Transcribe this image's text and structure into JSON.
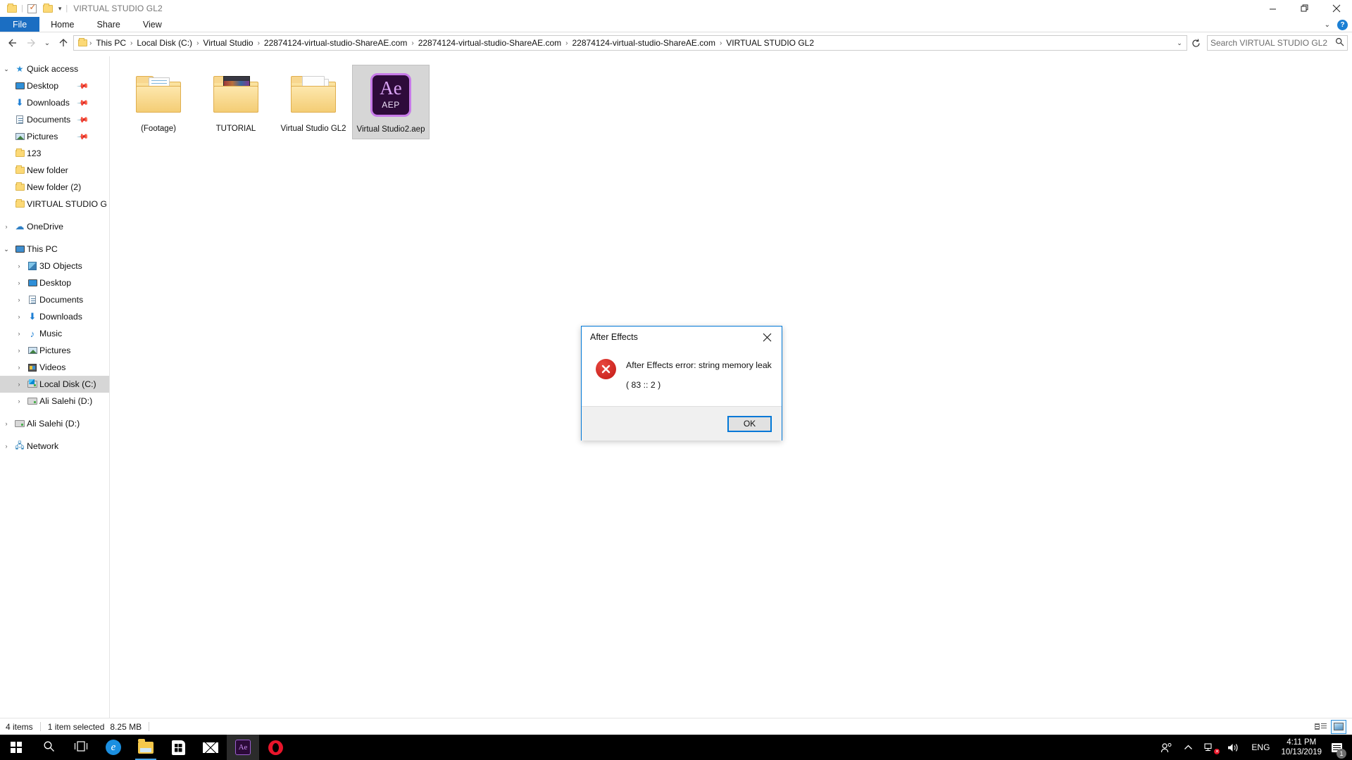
{
  "window": {
    "title": "VIRTUAL STUDIO GL2",
    "quick_access_toolbar": [
      {
        "name": "folder-properties-icon",
        "glyph": "folder"
      },
      {
        "name": "checkbox-icon",
        "glyph": "checkbox"
      },
      {
        "name": "new-folder-icon",
        "glyph": "folder"
      },
      {
        "name": "customize-qat-caret",
        "glyph": "▾"
      }
    ],
    "controls": {
      "minimize": "—",
      "restore": "❐",
      "close": "✕",
      "ribbon_collapse": "⌄",
      "help": "?"
    }
  },
  "ribbon": {
    "tabs": [
      {
        "label": "File",
        "active": true
      },
      {
        "label": "Home",
        "active": false
      },
      {
        "label": "Share",
        "active": false
      },
      {
        "label": "View",
        "active": false
      }
    ]
  },
  "nav": {
    "back_icon": "←",
    "forward_icon": "→",
    "recent_icon": "⌄",
    "up_icon": "↑",
    "refresh_icon": "⟳",
    "breadcrumbs": [
      "This PC",
      "Local Disk (C:)",
      "Virtual Studio",
      "22874124-virtual-studio-ShareAE.com",
      "22874124-virtual-studio-ShareAE.com",
      "22874124-virtual-studio-ShareAE.com",
      "VIRTUAL STUDIO GL2"
    ],
    "separator": "›",
    "dropdown_caret": "⌄"
  },
  "search": {
    "placeholder": "Search VIRTUAL STUDIO GL2",
    "icon": "⚲"
  },
  "sidebar": {
    "groups": [
      {
        "name": "quick-access",
        "label": "Quick access",
        "chevron": "⌄",
        "icon": "star-icon",
        "items": [
          {
            "label": "Desktop",
            "icon": "desktop-icon",
            "pinned": true
          },
          {
            "label": "Downloads",
            "icon": "downloads-icon",
            "pinned": true
          },
          {
            "label": "Documents",
            "icon": "documents-icon",
            "pinned": true
          },
          {
            "label": "Pictures",
            "icon": "pictures-icon",
            "pinned": true
          },
          {
            "label": "123",
            "icon": "folder-icon",
            "pinned": false
          },
          {
            "label": "New folder",
            "icon": "folder-icon",
            "pinned": false
          },
          {
            "label": "New folder (2)",
            "icon": "folder-icon",
            "pinned": false
          },
          {
            "label": "VIRTUAL STUDIO Gl",
            "icon": "folder-icon",
            "pinned": false
          }
        ]
      },
      {
        "name": "onedrive",
        "label": "OneDrive",
        "chevron": "›",
        "icon": "cloud-icon",
        "items": []
      },
      {
        "name": "this-pc",
        "label": "This PC",
        "chevron": "⌄",
        "icon": "pc-icon",
        "items": [
          {
            "label": "3D Objects",
            "icon": "3d-objects-icon",
            "chevron": "›"
          },
          {
            "label": "Desktop",
            "icon": "desktop-icon",
            "chevron": "›"
          },
          {
            "label": "Documents",
            "icon": "documents-icon",
            "chevron": "›"
          },
          {
            "label": "Downloads",
            "icon": "downloads-icon",
            "chevron": "›"
          },
          {
            "label": "Music",
            "icon": "music-icon",
            "chevron": "›"
          },
          {
            "label": "Pictures",
            "icon": "pictures-icon",
            "chevron": "›"
          },
          {
            "label": "Videos",
            "icon": "videos-icon",
            "chevron": "›"
          },
          {
            "label": "Local Disk (C:)",
            "icon": "local-disk-icon",
            "chevron": "›",
            "selected": true
          },
          {
            "label": "Ali Salehi (D:)",
            "icon": "drive-icon",
            "chevron": "›"
          }
        ]
      },
      {
        "name": "ali-salehi-drive",
        "label": "Ali Salehi (D:)",
        "chevron": "›",
        "icon": "drive-icon",
        "items": []
      },
      {
        "name": "network",
        "label": "Network",
        "chevron": "›",
        "icon": "network-icon",
        "items": []
      }
    ]
  },
  "files": {
    "items": [
      {
        "label": "(Footage)",
        "type": "folder-documents",
        "selected": false
      },
      {
        "label": "TUTORIAL",
        "type": "folder-photos",
        "selected": false
      },
      {
        "label": "Virtual Studio GL2",
        "type": "folder-white",
        "selected": false
      },
      {
        "label": "Virtual Studio2.aep",
        "type": "aep-file",
        "selected": true,
        "icon_text": "Ae",
        "icon_ext": "AEP"
      }
    ]
  },
  "statusbar": {
    "item_count": "4 items",
    "selection": "1 item selected",
    "size": "8.25 MB",
    "views": [
      {
        "name": "details-view-button",
        "active": false
      },
      {
        "name": "large-icons-view-button",
        "active": true
      }
    ]
  },
  "dialog": {
    "title": "After Effects",
    "close_icon": "✕",
    "error_icon": "✕",
    "message_line1": "After Effects error: string memory leak",
    "message_line2": "( 83 :: 2 )",
    "ok_label": "OK"
  },
  "taskbar": {
    "items": [
      {
        "name": "start-button",
        "icon": "windows-logo"
      },
      {
        "name": "search-button",
        "icon": "search-icon"
      },
      {
        "name": "task-view-button",
        "icon": "task-view-icon"
      },
      {
        "name": "edge-button",
        "icon": "edge-icon",
        "glyph": "e"
      },
      {
        "name": "file-explorer-button",
        "icon": "folder-icon",
        "running": true
      },
      {
        "name": "microsoft-store-button",
        "icon": "store-icon"
      },
      {
        "name": "mail-button",
        "icon": "mail-icon"
      },
      {
        "name": "after-effects-button",
        "icon": "after-effects-icon",
        "glyph": "Ae",
        "active": true
      },
      {
        "name": "opera-button",
        "icon": "opera-icon"
      }
    ],
    "tray": {
      "people_icon": "ể",
      "show_hidden_icon": "⌃",
      "network_icon": "network-error-icon",
      "volume_icon": "ὐa",
      "language": "ENG",
      "time": "4:11 PM",
      "date": "10/13/2019",
      "notification_count": "1"
    }
  },
  "colors": {
    "accent": "#0078d7",
    "file_tab": "#1b6ec2",
    "selection": "#d6d6d6",
    "error_red": "#c21a15",
    "aep_purple": "#c77ae8",
    "taskbar": "#000000"
  }
}
